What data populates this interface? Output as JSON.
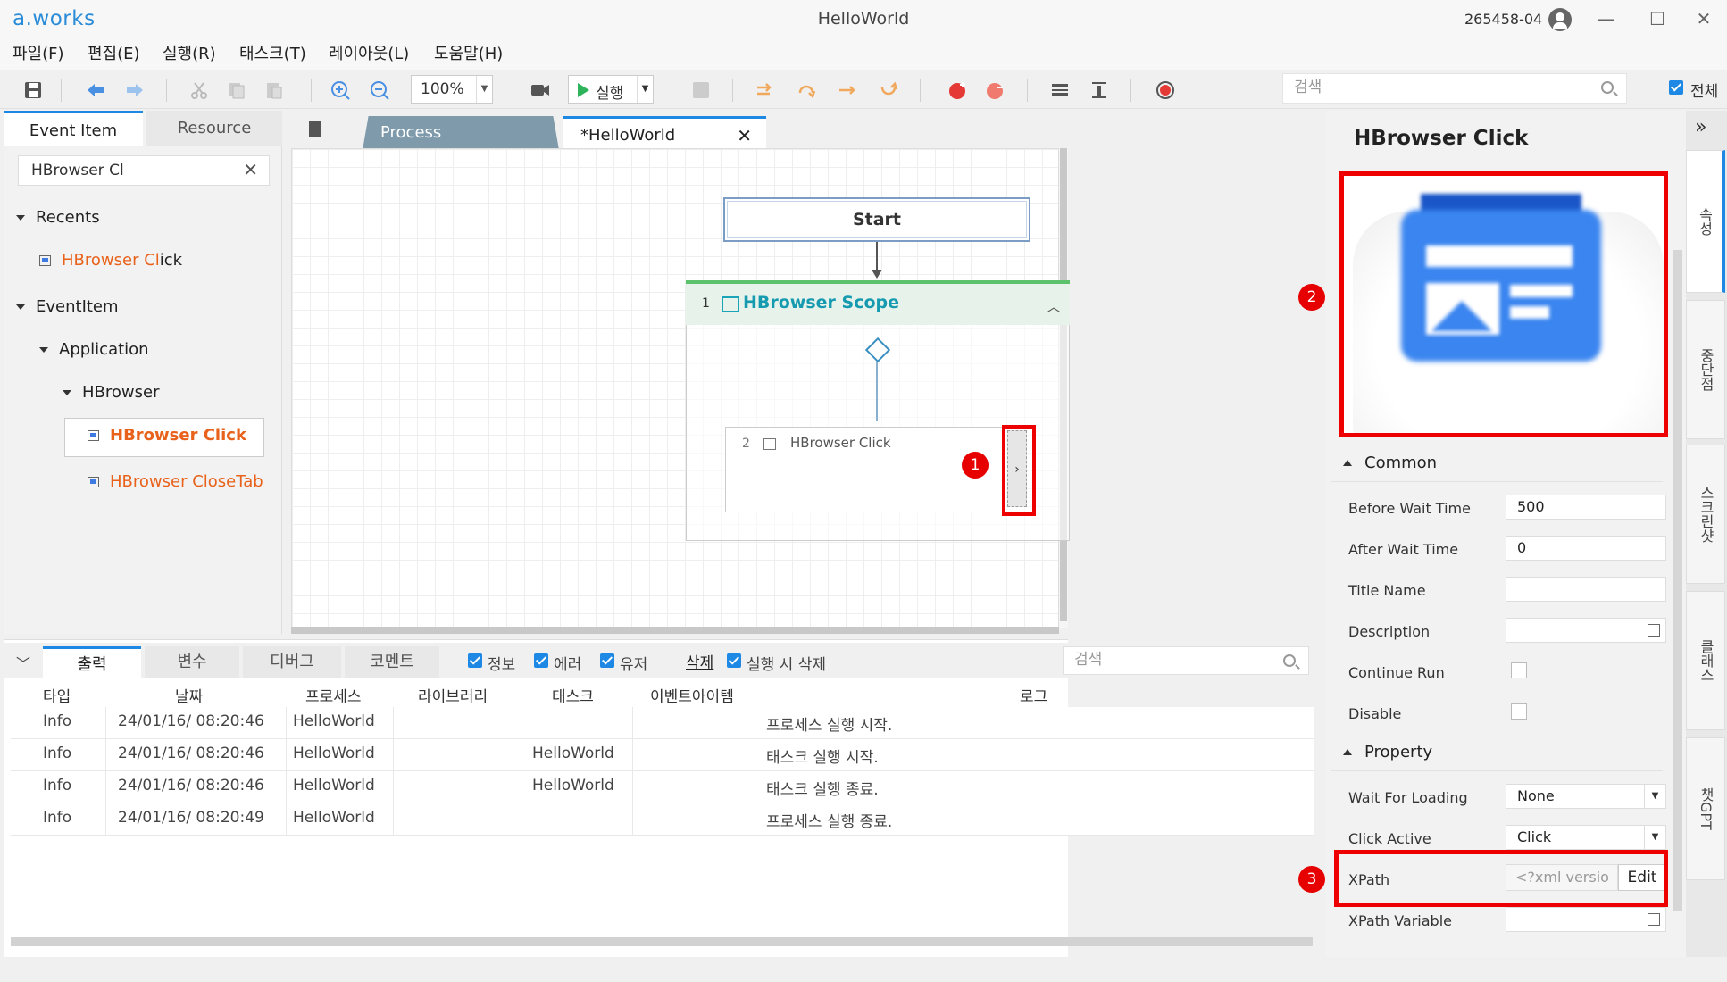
{
  "window": {
    "logo": "a.works",
    "title": "HelloWorld",
    "user_id": "265458-04",
    "minimize": "—",
    "maximize": "☐",
    "close": "✕"
  },
  "menu": [
    "파일(F)",
    "편집(E)",
    "실행(R)",
    "태스크(T)",
    "레이아웃(L)",
    "도움말(H)"
  ],
  "toolbar": {
    "zoom": "100%",
    "run_label": "실행",
    "search_placeholder": "검색",
    "all_label": "전체"
  },
  "left_panel": {
    "tabs": [
      "Event Item",
      "Resource"
    ],
    "search_value": "HBrowser Cl",
    "tree": {
      "recents": "Recents",
      "recent_item_prefix": "HBrowser Cl",
      "recent_item_suffix": "ick",
      "eventitem": "EventItem",
      "application": "Application",
      "hbrowser": "HBrowser",
      "item_click": "HBrowser Click",
      "item_closetab_prefix": "HBrowser Cl",
      "item_closetab_suffix": "oseTab"
    }
  },
  "doc_tabs": [
    "Process",
    "*HelloWorld"
  ],
  "workflow": {
    "start": "Start",
    "scope_num": "1",
    "scope_title": "HBrowser Scope",
    "activity_num": "2",
    "activity_title": "HBrowser Click",
    "expand_glyph": "›"
  },
  "badges": [
    "1",
    "2",
    "3"
  ],
  "bottom_panel": {
    "tabs": [
      "출력",
      "변수",
      "디버그",
      "코멘트"
    ],
    "filters": [
      "정보",
      "에러",
      "유저"
    ],
    "delete_label": "삭제",
    "delete_on_run": "실행 시 삭제",
    "search_placeholder": "검색",
    "columns": [
      "타입",
      "날짜",
      "프로세스",
      "라이브러리",
      "태스크",
      "이벤트아이템",
      "로그"
    ],
    "rows": [
      {
        "type": "Info",
        "date": "24/01/16/ 08:20:46",
        "process": "HelloWorld",
        "library": "",
        "task": "",
        "event": "",
        "log": "프로세스 실행 시작."
      },
      {
        "type": "Info",
        "date": "24/01/16/ 08:20:46",
        "process": "HelloWorld",
        "library": "",
        "task": "HelloWorld",
        "event": "",
        "log": "태스크 실행 시작."
      },
      {
        "type": "Info",
        "date": "24/01/16/ 08:20:46",
        "process": "HelloWorld",
        "library": "",
        "task": "HelloWorld",
        "event": "",
        "log": "태스크 실행 종료."
      },
      {
        "type": "Info",
        "date": "24/01/16/ 08:20:49",
        "process": "HelloWorld",
        "library": "",
        "task": "",
        "event": "",
        "log": "프로세스 실행 종료."
      }
    ]
  },
  "right_panel": {
    "title": "HBrowser Click",
    "common_section": "Common",
    "property_section": "Property",
    "fields": {
      "before_wait_label": "Before Wait Time",
      "before_wait_value": "500",
      "after_wait_label": "After Wait Time",
      "after_wait_value": "0",
      "title_name_label": "Title Name",
      "description_label": "Description",
      "continue_run_label": "Continue Run",
      "disable_label": "Disable",
      "wait_loading_label": "Wait For Loading",
      "wait_loading_value": "None",
      "click_active_label": "Click Active",
      "click_active_value": "Click",
      "xpath_label": "XPath",
      "xpath_value": "<?xml versio",
      "xpath_edit": "Edit",
      "xpath_variable_label": "XPath Variable"
    },
    "side_tabs": [
      "속성",
      "중단점",
      "스크린샷",
      "클래스",
      "챗GPT"
    ]
  }
}
